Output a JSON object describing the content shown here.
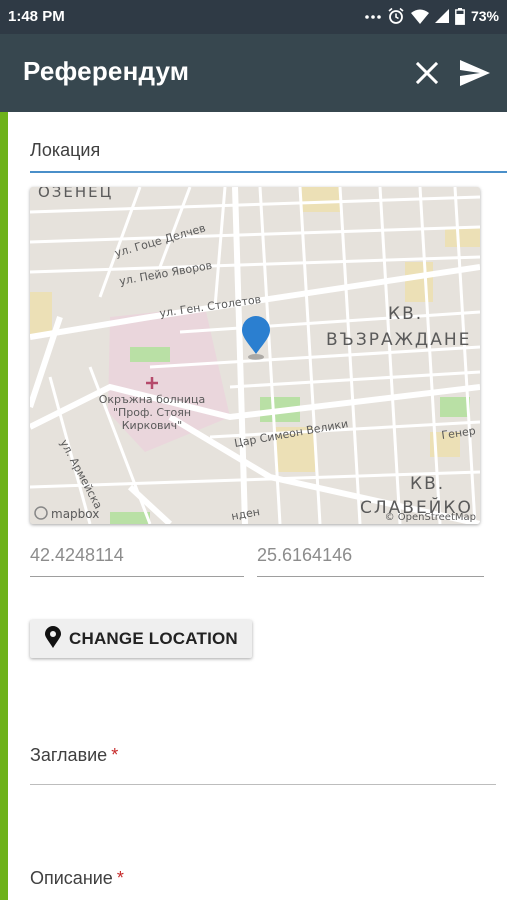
{
  "status_bar": {
    "time": "1:48 PM",
    "battery": "73%"
  },
  "app_bar": {
    "title": "Референдум"
  },
  "location": {
    "label": "Локация",
    "latitude": "42.4248114",
    "longitude": "25.6164146",
    "change_button": "CHANGE LOCATION"
  },
  "map": {
    "streets": [
      "ОЗЕНЕЦ",
      "ул. Гоце Делчев",
      "ул. Пейо Яворов",
      "ул. Ген. Столетов",
      "Цар Симеон Велики",
      "ул. Армейска",
      "Генер",
      "нден"
    ],
    "districts": [
      "КВ.",
      "ВЪЗРАЖДАНЕ",
      "КВ.",
      "СЛАВЕЙКО"
    ],
    "hospital": [
      "Окръжна болница",
      "\"Проф. Стоян",
      "Киркович\""
    ],
    "attribution_left": "mapbox",
    "attribution_right": "© OpenStreetMap"
  },
  "fields": {
    "title_label": "Заглавие",
    "description_label": "Описание",
    "required_mark": "*"
  },
  "colors": {
    "app_bar": "#37474f",
    "status_bar": "#2f3a45",
    "accent": "#6db21a",
    "focus_line": "#4a8fc9",
    "map_pin": "#2b7fd0"
  }
}
